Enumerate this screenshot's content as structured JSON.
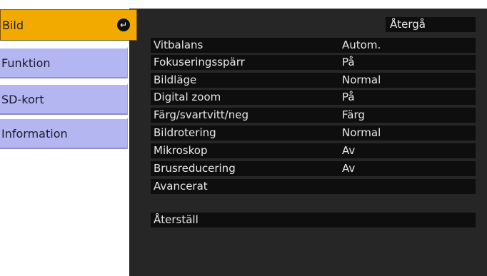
{
  "tabs": [
    {
      "label": "Bild",
      "active": true
    },
    {
      "label": "Funktion",
      "active": false
    },
    {
      "label": "SD-kort",
      "active": false
    },
    {
      "label": "Information",
      "active": false
    }
  ],
  "back_label": "Återgå",
  "settings": [
    {
      "label": "Vitbalans",
      "value": "Autom."
    },
    {
      "label": "Fokuseringsspärr",
      "value": "På"
    },
    {
      "label": "Bildläge",
      "value": "Normal"
    },
    {
      "label": "Digital zoom",
      "value": "På"
    },
    {
      "label": "Färg/svartvitt/neg",
      "value": "Färg"
    },
    {
      "label": "Bildrotering",
      "value": "Normal"
    },
    {
      "label": "Mikroskop",
      "value": "Av"
    },
    {
      "label": "Brusreducering",
      "value": "Av"
    },
    {
      "label": "Avancerat",
      "value": ""
    }
  ],
  "reset_label": "Återställ",
  "colors": {
    "active_tab": "#f2a900",
    "inactive_tab": "#b3b6f0",
    "panel": "#262626",
    "row": "#0e0e0e"
  },
  "icons": {
    "active_tab_marker": "enter-arrow-icon"
  }
}
